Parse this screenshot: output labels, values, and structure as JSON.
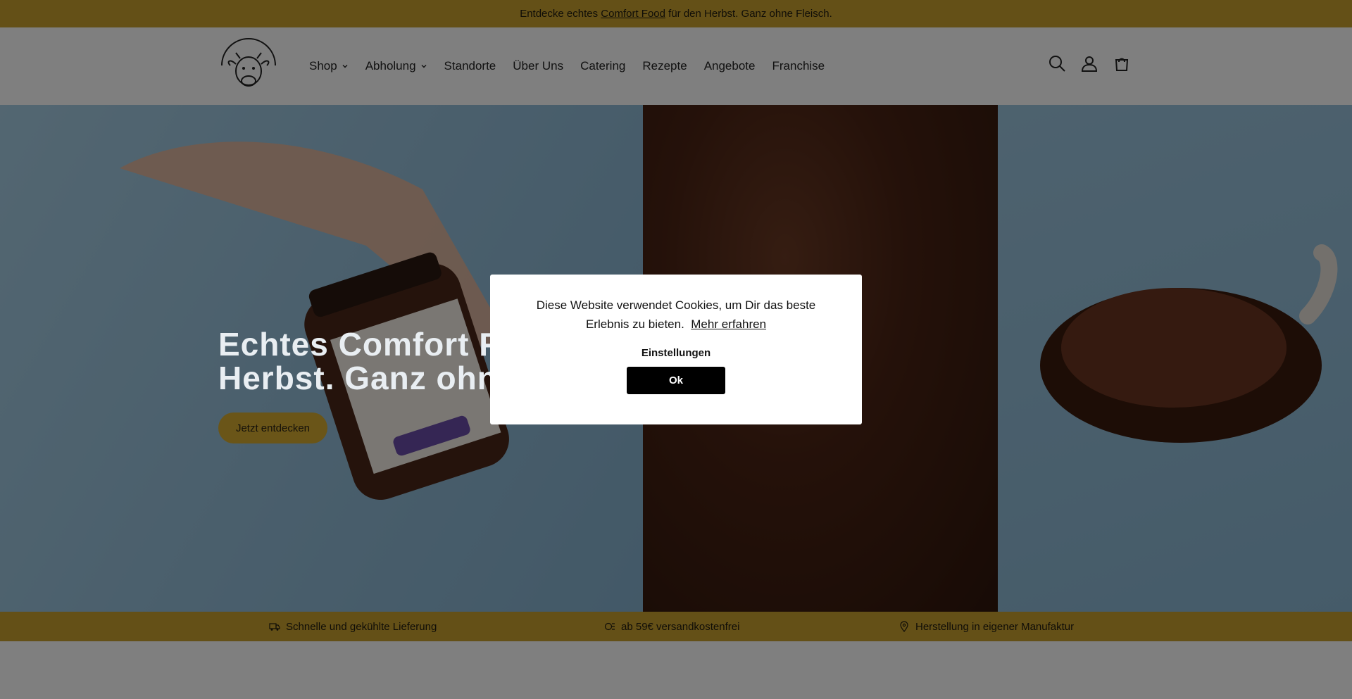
{
  "announcement": {
    "prefix": "Entdecke echtes",
    "link": "Comfort Food",
    "suffix": "für den Herbst. Ganz ohne Fleisch."
  },
  "header": {
    "nav": [
      {
        "label": "Shop",
        "has_dropdown": true
      },
      {
        "label": "Abholung",
        "has_dropdown": true
      },
      {
        "label": "Standorte"
      },
      {
        "label": "Über Uns"
      },
      {
        "label": "Catering"
      },
      {
        "label": "Rezepte"
      },
      {
        "label": "Angebote"
      },
      {
        "label": "Franchise"
      }
    ],
    "icons": [
      "search-icon",
      "account-icon",
      "cart-icon"
    ]
  },
  "hero": {
    "title": "Echtes Comfort Food für den Herbst. Ganz ohne Fleisch.",
    "button": "Jetzt entdecken"
  },
  "benefits": [
    {
      "icon": "delivery-truck-icon",
      "label": "Schnelle und gekühlte Lieferung"
    },
    {
      "icon": "shipping-money-icon",
      "label": "ab 59€ versandkostenfrei"
    },
    {
      "icon": "location-pin-icon",
      "label": "Herstellung in eigener Manufaktur"
    }
  ],
  "cookie_modal": {
    "text": "Diese Website verwendet Cookies, um Dir das beste Erlebnis zu bieten.",
    "link": "Mehr erfahren",
    "settings": "Einstellungen",
    "ok": "Ok"
  },
  "colors": {
    "accent": "#c9a12f",
    "overlay": "rgba(0,0,0,0.5)",
    "modal_button": "#000000"
  }
}
